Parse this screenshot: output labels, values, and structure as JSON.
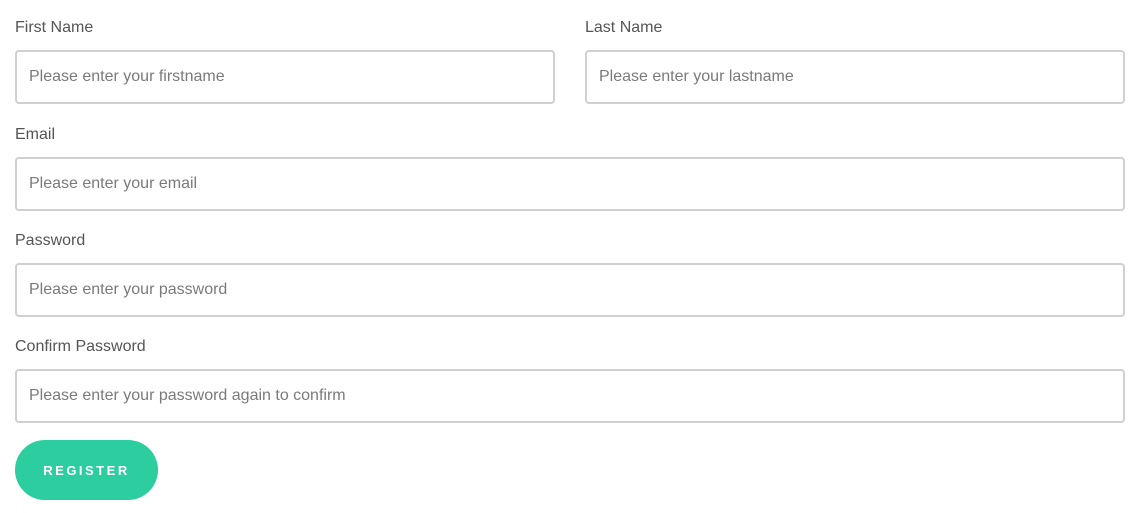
{
  "form": {
    "first_name": {
      "label": "First Name",
      "placeholder": "Please enter your firstname",
      "value": ""
    },
    "last_name": {
      "label": "Last Name",
      "placeholder": "Please enter your lastname",
      "value": ""
    },
    "email": {
      "label": "Email",
      "placeholder": "Please enter your email",
      "value": ""
    },
    "password": {
      "label": "Password",
      "placeholder": "Please enter your password",
      "value": ""
    },
    "confirm_password": {
      "label": "Confirm Password",
      "placeholder": "Please enter your password again to confirm",
      "value": ""
    },
    "register_label": "REGISTER"
  },
  "colors": {
    "accent": "#2ccd9f",
    "field_border": "#d0d0d0",
    "label_text": "#555555",
    "placeholder_text": "#7a7a7a"
  }
}
